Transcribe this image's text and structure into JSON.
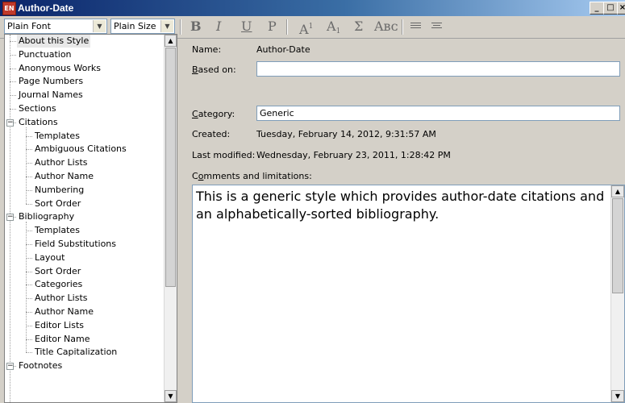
{
  "window": {
    "title": "Author-Date",
    "app_icon_label": "EN",
    "controls": {
      "minimize": "_",
      "maximize": "□",
      "close": "×"
    }
  },
  "toolbar": {
    "font_combo": "Plain Font",
    "size_combo": "Plain Size",
    "bold": "B",
    "italic": "I",
    "underline": "U",
    "plain": "P",
    "superscript_base": "A",
    "superscript_mark": "1",
    "subscript_base": "A",
    "subscript_mark": "1",
    "symbol": "Σ",
    "small_caps": "Aʙᴄ"
  },
  "tree": {
    "items": [
      {
        "label": "About this Style",
        "level": 0,
        "selected": true
      },
      {
        "label": "Punctuation",
        "level": 0
      },
      {
        "label": "Anonymous Works",
        "level": 0
      },
      {
        "label": "Page Numbers",
        "level": 0
      },
      {
        "label": "Journal Names",
        "level": 0
      },
      {
        "label": "Sections",
        "level": 0
      },
      {
        "label": "Citations",
        "level": 0,
        "expander": "−"
      },
      {
        "label": "Templates",
        "level": 1
      },
      {
        "label": "Ambiguous Citations",
        "level": 1
      },
      {
        "label": "Author Lists",
        "level": 1
      },
      {
        "label": "Author Name",
        "level": 1
      },
      {
        "label": "Numbering",
        "level": 1
      },
      {
        "label": "Sort Order",
        "level": 1
      },
      {
        "label": "Bibliography",
        "level": 0,
        "expander": "−"
      },
      {
        "label": "Templates",
        "level": 1
      },
      {
        "label": "Field Substitutions",
        "level": 1
      },
      {
        "label": "Layout",
        "level": 1
      },
      {
        "label": "Sort Order",
        "level": 1
      },
      {
        "label": "Categories",
        "level": 1
      },
      {
        "label": "Author Lists",
        "level": 1
      },
      {
        "label": "Author Name",
        "level": 1
      },
      {
        "label": "Editor Lists",
        "level": 1
      },
      {
        "label": "Editor Name",
        "level": 1
      },
      {
        "label": "Title Capitalization",
        "level": 1
      },
      {
        "label": "Footnotes",
        "level": 0,
        "expander": "−"
      }
    ]
  },
  "details": {
    "name_label": "Name:",
    "name_value": "Author-Date",
    "based_on_label_u": "B",
    "based_on_label_rest": "ased on:",
    "based_on_value": "",
    "category_label_u": "C",
    "category_label_rest": "ategory:",
    "category_value": "Generic",
    "created_label": "Created:",
    "created_value": "Tuesday, February 14, 2012, 9:31:57 AM",
    "modified_label": "Last modified:",
    "modified_value": "Wednesday, February 23, 2011, 1:28:42 PM",
    "comments_label_pre": "C",
    "comments_label_u": "o",
    "comments_label_rest": "mments and limitations:",
    "comments_text": "This is a generic style which provides author-date citations and an alphabetically-sorted bibliography."
  },
  "icons": {
    "scroll_up": "▲",
    "scroll_down": "▼",
    "combo_arrow": "▼"
  }
}
